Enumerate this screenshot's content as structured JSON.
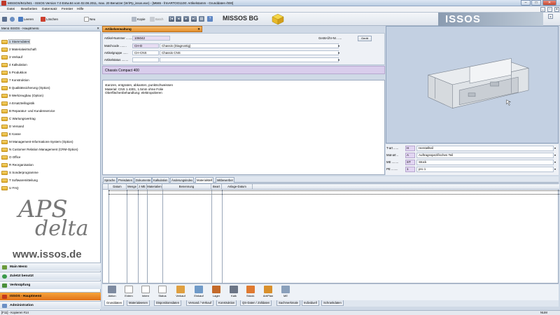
{
  "window": {
    "title": "MISSOS/941/941 - ISSOS Version 7.0 Entw.84 vom 02.08.2011, max. 20 Benutzer (W:\\Pp_issos.exe) - [M665 - frmARTOO1100: Artikelstamm - Grunddaten /000]",
    "minimize": "–",
    "maximize": "□",
    "close": "✕"
  },
  "menu": [
    "Datei",
    "Bearbeiten",
    "Datensatz",
    "Fenster",
    "Hilfe"
  ],
  "toolbar": {
    "leeren": "Leeren",
    "loeschen": "Löschen",
    "neu": "Neu",
    "kopie": "Kopie",
    "batch": "Batch",
    "company": "MISSOS BG",
    "logo": "ISSOS"
  },
  "sidebar": {
    "header": "Menü ISSOS - Hauptmenü",
    "items": [
      {
        "label": "1 Stammdaten"
      },
      {
        "label": "2 Materialwirtschaft"
      },
      {
        "label": "3 Verkauf"
      },
      {
        "label": "4 Kalkulation"
      },
      {
        "label": "5 Produktion"
      },
      {
        "label": "7 Konstruktion"
      },
      {
        "label": "8 Qualitätssicherung (Option)"
      },
      {
        "label": "9 Werkzeugbau (Option)"
      },
      {
        "label": "A Ersatzteillogistik"
      },
      {
        "label": "B Reparatur- und Kundenservice"
      },
      {
        "label": "C Wartungsvertrag"
      },
      {
        "label": "D Versand"
      },
      {
        "label": "E Kasse"
      },
      {
        "label": "M Management-Informations-System (Option)"
      },
      {
        "label": "N Customer Relation Management (CRM-Option)"
      },
      {
        "label": "O Office"
      },
      {
        "label": "R Reorganisation"
      },
      {
        "label": "S Sonderprogramme"
      },
      {
        "label": "T Softwaremitteilung"
      },
      {
        "label": "U FAQ"
      }
    ],
    "brand_top": "APS",
    "brand_bottom": "delta",
    "brand_url": "www.issos.de",
    "nav": [
      {
        "label": "Main Menü"
      },
      {
        "label": "Zuletzt benutzt"
      },
      {
        "label": "Verknüpfung"
      },
      {
        "label": "ISSOS - Hauptmenü"
      },
      {
        "label": "Administration"
      }
    ]
  },
  "form": {
    "tab": "Artikelverwaltung",
    "artikelnummer_label": "Artikel-Nummer ........",
    "artikelnummer": "106042",
    "geraet_label": "Gerät-Ühr-Nr. .....",
    "geraet_button": "Gerät",
    "matchcode_label": "Matchcode ........",
    "matchcode_code": "CH-D",
    "matchcode_text": "Chassis (Diagnostig)",
    "gruppe_label": "Artikelgruppe ......",
    "gruppe_code": "CH-CNS",
    "gruppe_text": "Chassis CNS",
    "status_label": "Artikelstatus ........",
    "description_title": "Chassis Compact 400",
    "description_lines": [
      "stanzen, entgraten, abkanten, punktschweissen",
      "Material: CNS 1.4301, 1.5mm ohne Folie",
      "Oberflächenbehandlung: elektropolieren"
    ]
  },
  "properties": [
    {
      "label": "T-art ......",
      "code": "H",
      "text": "Herstellteil"
    },
    {
      "label": "Mat-art ..",
      "code": "A",
      "text": "Auftragsspezifisches Teil"
    },
    {
      "label": "ME ........",
      "code": "ST",
      "text": "Stück"
    },
    {
      "label": "PE ........",
      "code": "1",
      "text": "pro 1"
    }
  ],
  "subtabs": [
    "Sprache",
    "Preisdaten",
    "Dokumente",
    "Kalkulation",
    "Änderungsindex",
    "Materialstell",
    "Mitbewerber"
  ],
  "grid_columns": [
    "Datum",
    "Menge",
    "z ME",
    "Materialien",
    "Benennung",
    "Beart",
    "Anlage-Datum"
  ],
  "actions": [
    "Aktion",
    "Extern",
    "Intern",
    "Status",
    "Verkauf",
    "Einkauf",
    "Lager",
    "Kalk",
    "Stückl.",
    "ArbPlan",
    "ME"
  ],
  "bottom_tabs": [
    "Grunddaten",
    "Materialwesen",
    "Dispositionsdaten",
    "Versand / Verkauf",
    "Konstruktion",
    "QS-Daten / Zolldaten",
    "Sachmerkmale",
    "Individuell",
    "Schrankdaten"
  ],
  "status": {
    "left": "[F11] - Kopieren #14",
    "right": "NUM"
  },
  "colors": {
    "accent": "#e3892a",
    "highlight": "#d9cdec",
    "folder": "#f2c94c"
  }
}
